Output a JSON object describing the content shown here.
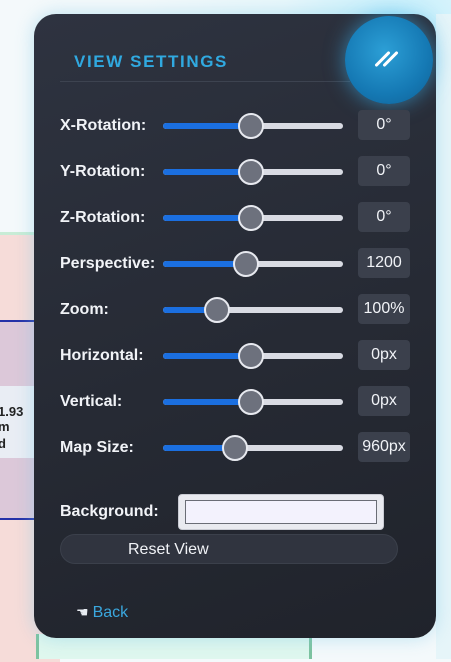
{
  "panel": {
    "title": "VIEW SETTINGS",
    "toggle_icon": "double-slash-icon"
  },
  "sliders": [
    {
      "label": "X-Rotation:",
      "value": "0°",
      "fraction": 0.49
    },
    {
      "label": "Y-Rotation:",
      "value": "0°",
      "fraction": 0.49
    },
    {
      "label": "Z-Rotation:",
      "value": "0°",
      "fraction": 0.49
    },
    {
      "label": "Perspective:",
      "value": "1200",
      "fraction": 0.46
    },
    {
      "label": "Zoom:",
      "value": "100%",
      "fraction": 0.3
    },
    {
      "label": "Horizontal:",
      "value": "0px",
      "fraction": 0.49
    },
    {
      "label": "Vertical:",
      "value": "0px",
      "fraction": 0.49
    },
    {
      "label": "Map Size:",
      "value": "960px",
      "fraction": 0.4
    }
  ],
  "background": {
    "label": "Background:",
    "color": "#f3f2fd"
  },
  "reset_label": "Reset View",
  "back_label": "Back",
  "background_app": {
    "value_text": "1.93 m",
    "sub_text": "d"
  },
  "colors": {
    "accent": "#30a9e0",
    "slider_fill": "#1b6fe0",
    "panel_bg": "#262a34"
  }
}
